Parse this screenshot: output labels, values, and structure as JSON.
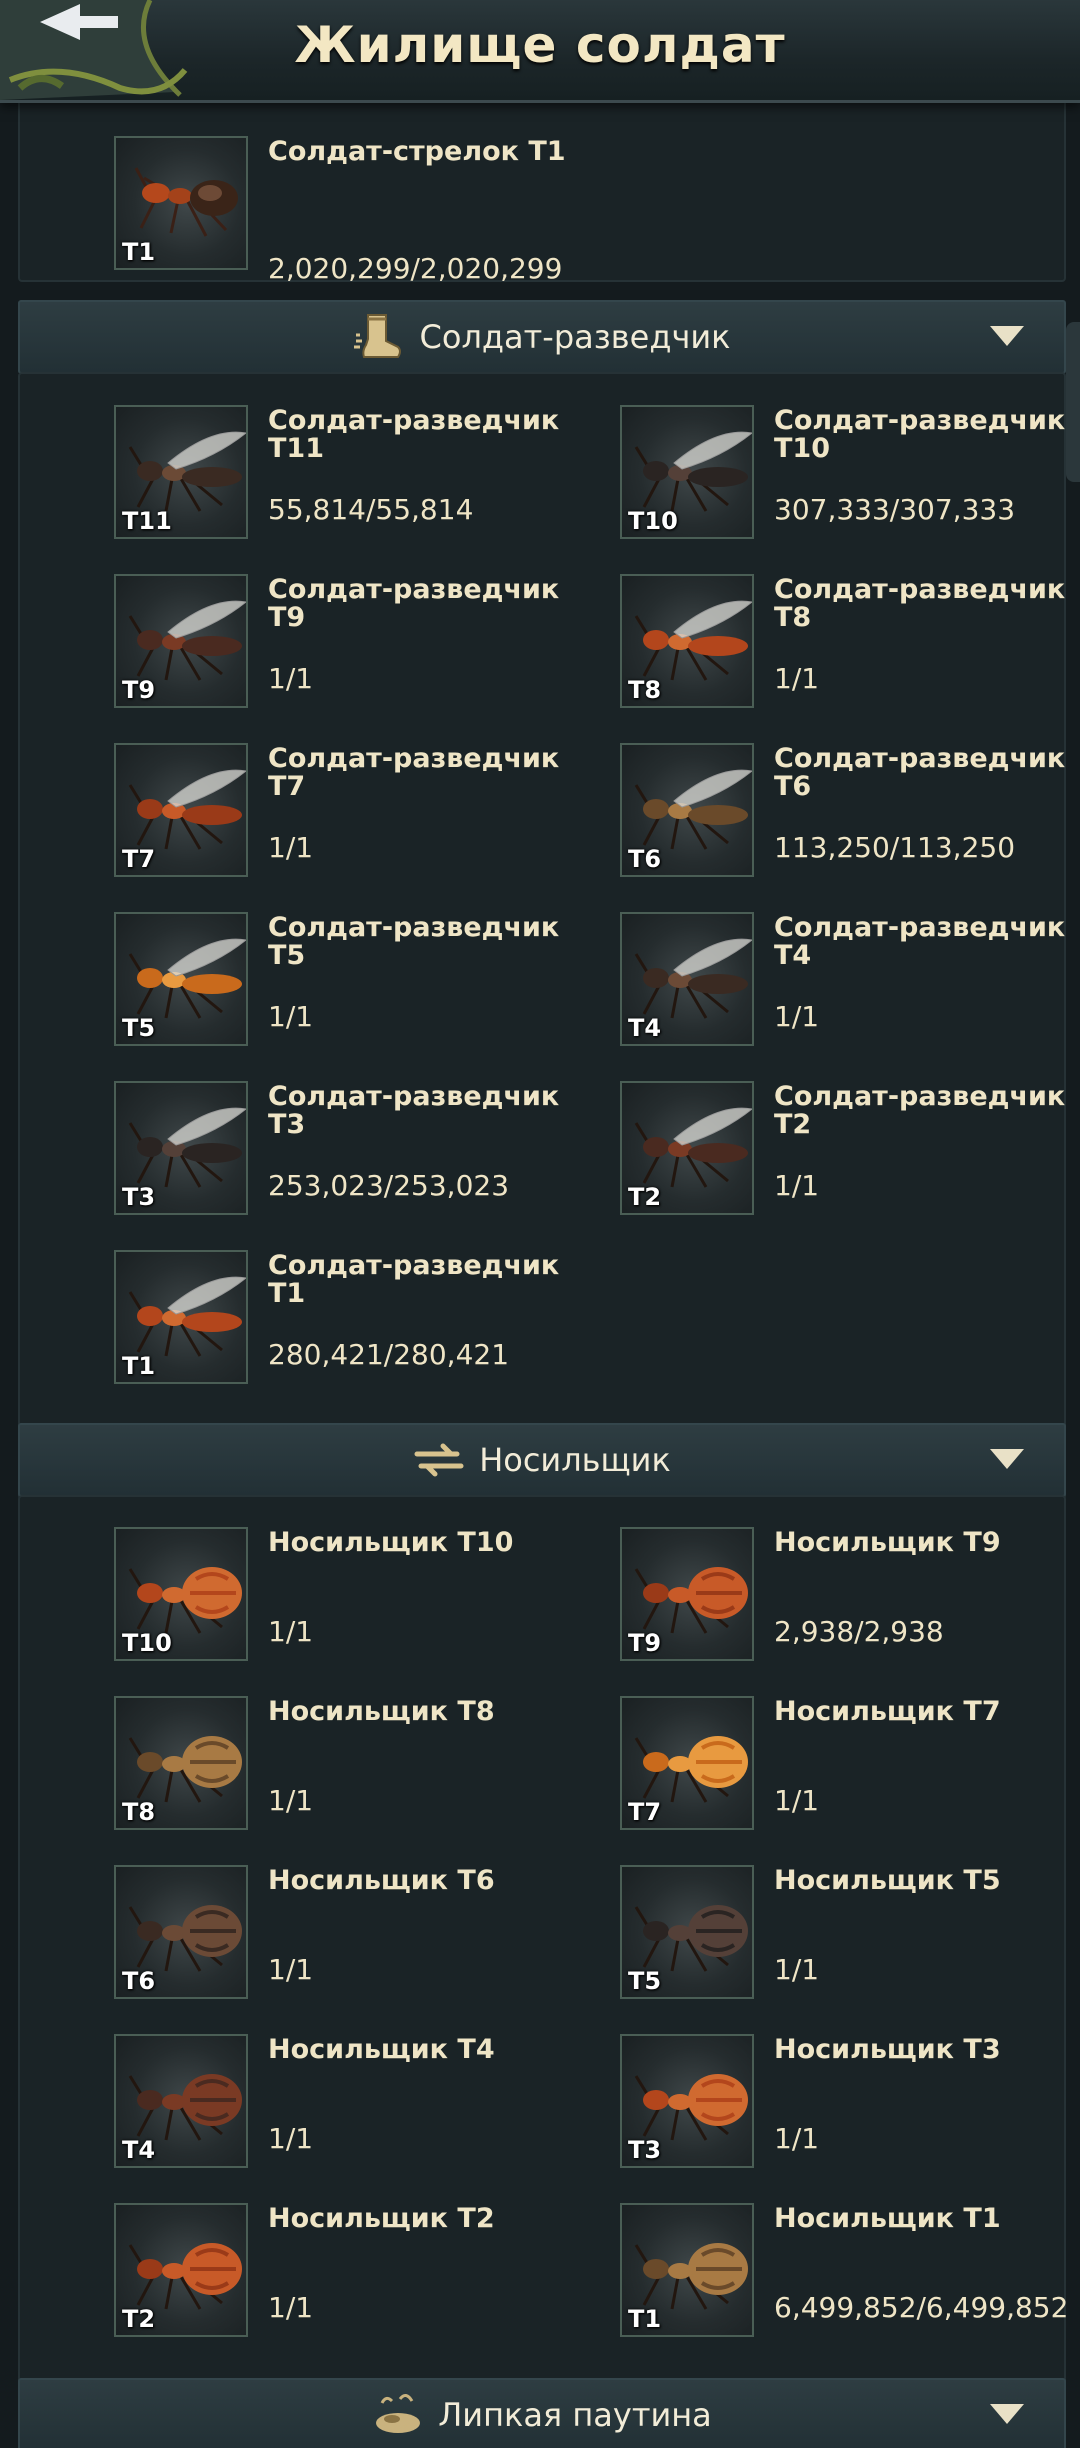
{
  "header": {
    "title": "Жилище солдат",
    "back_icon": "back-arrow-icon"
  },
  "top_unit": {
    "name": "Солдат-стрелок T1",
    "count": "2,020,299/2,020,299",
    "tier": "T1",
    "icon": "ant-icon"
  },
  "sections": [
    {
      "label": "Солдат-разведчик",
      "icon": "boot-icon",
      "units": [
        {
          "name": "Солдат-разведчик T11",
          "count": "55,814/55,814",
          "tier": "T11"
        },
        {
          "name": "Солдат-разведчик T10",
          "count": "307,333/307,333",
          "tier": "T10"
        },
        {
          "name": "Солдат-разведчик T9",
          "count": "1/1",
          "tier": "T9"
        },
        {
          "name": "Солдат-разведчик T8",
          "count": "1/1",
          "tier": "T8"
        },
        {
          "name": "Солдат-разведчик T7",
          "count": "1/1",
          "tier": "T7"
        },
        {
          "name": "Солдат-разведчик T6",
          "count": "113,250/113,250",
          "tier": "T6"
        },
        {
          "name": "Солдат-разведчик T5",
          "count": "1/1",
          "tier": "T5"
        },
        {
          "name": "Солдат-разведчик T4",
          "count": "1/1",
          "tier": "T4"
        },
        {
          "name": "Солдат-разведчик T3",
          "count": "253,023/253,023",
          "tier": "T3"
        },
        {
          "name": "Солдат-разведчик T2",
          "count": "1/1",
          "tier": "T2"
        },
        {
          "name": "Солдат-разведчик T1",
          "count": "280,421/280,421",
          "tier": "T1"
        }
      ]
    },
    {
      "label": "Носильщик",
      "icon": "swap-arrows-icon",
      "units": [
        {
          "name": "Носильщик T10",
          "count": "1/1",
          "tier": "T10"
        },
        {
          "name": "Носильщик T9",
          "count": "2,938/2,938",
          "tier": "T9"
        },
        {
          "name": "Носильщик T8",
          "count": "1/1",
          "tier": "T8"
        },
        {
          "name": "Носильщик T7",
          "count": "1/1",
          "tier": "T7"
        },
        {
          "name": "Носильщик T6",
          "count": "1/1",
          "tier": "T6"
        },
        {
          "name": "Носильщик T5",
          "count": "1/1",
          "tier": "T5"
        },
        {
          "name": "Носильщик T4",
          "count": "1/1",
          "tier": "T4"
        },
        {
          "name": "Носильщик T3",
          "count": "1/1",
          "tier": "T3"
        },
        {
          "name": "Носильщик T2",
          "count": "1/1",
          "tier": "T2"
        },
        {
          "name": "Носильщик T1",
          "count": "6,499,852/6,499,852",
          "tier": "T1"
        }
      ]
    },
    {
      "label": "Липкая паутина",
      "icon": "web-icon",
      "units": []
    }
  ],
  "colors": {
    "background": "#141b1e",
    "section_header": "#2a393e",
    "text": "#efe5c6",
    "thumb_border": "#4a5e55"
  }
}
